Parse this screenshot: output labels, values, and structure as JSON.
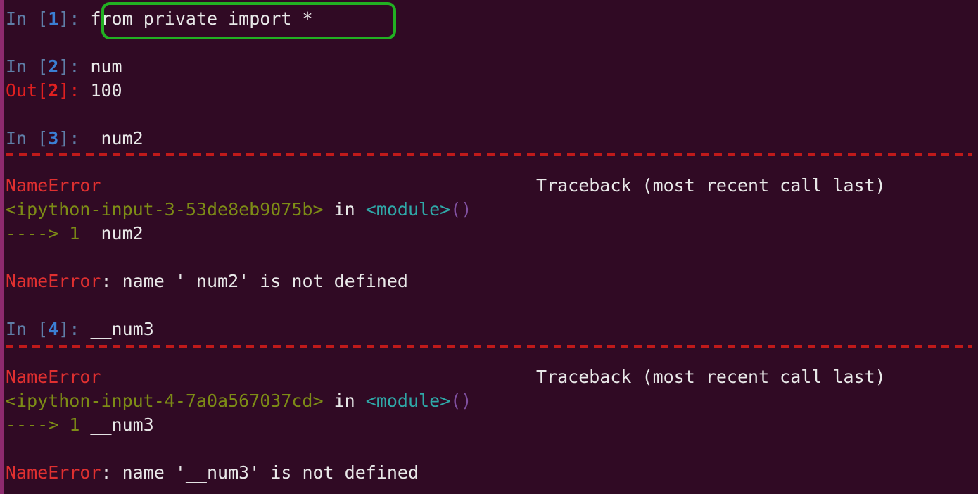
{
  "terminal": {
    "app": "IPython console",
    "background_color": "#300a24",
    "left_edge_color": "#8e2a6e",
    "highlight_box_color": "#22b022",
    "separator_color": "#c01a1a"
  },
  "cells": [
    {
      "prompt_label": "In ",
      "prompt_open": "[",
      "prompt_number": "1",
      "prompt_close": "]: ",
      "input": "from private import *",
      "highlighted": true
    },
    {
      "prompt_label": "In ",
      "prompt_open": "[",
      "prompt_number": "2",
      "prompt_close": "]: ",
      "input": "num",
      "out_label": "Out",
      "out_open": "[",
      "out_number": "2",
      "out_close": "]: ",
      "output": "100"
    },
    {
      "prompt_label": "In ",
      "prompt_open": "[",
      "prompt_number": "3",
      "prompt_close": "]: ",
      "input": "_num2"
    },
    {
      "prompt_label": "In ",
      "prompt_open": "[",
      "prompt_number": "4",
      "prompt_close": "]: ",
      "input": "__num3"
    }
  ],
  "traceback_1": {
    "exception_name": "NameError",
    "traceback_header": "Traceback (most recent call last)",
    "frame_file": "<ipython-input-3-53de8eb9075b>",
    "frame_in": " in ",
    "frame_module": "<module>",
    "frame_parens": "()",
    "arrow": "----> ",
    "line_number": "1",
    "code_line": " _num2",
    "message_prefix": "NameError",
    "message_body": ": name '_num2' is not defined"
  },
  "traceback_2": {
    "exception_name": "NameError",
    "traceback_header": "Traceback (most recent call last)",
    "frame_file": "<ipython-input-4-7a0a567037cd>",
    "frame_in": " in ",
    "frame_module": "<module>",
    "frame_parens": "()",
    "arrow": "----> ",
    "line_number": "1",
    "code_line": " __num3",
    "message_prefix": "NameError",
    "message_body": ": name '__num3' is not defined"
  }
}
